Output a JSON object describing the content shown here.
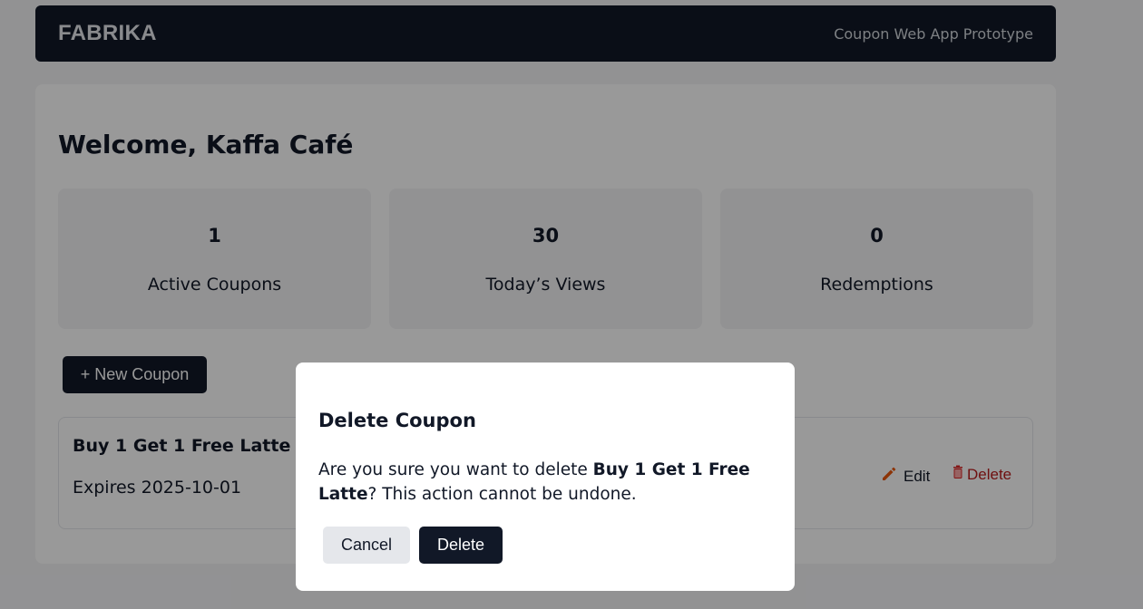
{
  "header": {
    "brand": "FABRIKA",
    "tagline": "Coupon Web App Prototype"
  },
  "dashboard": {
    "welcome": "Welcome, Kaffa Café",
    "stats": [
      {
        "value": "1",
        "label": "Active Coupons"
      },
      {
        "value": "30",
        "label": "Today’s Views"
      },
      {
        "value": "0",
        "label": "Redemptions"
      }
    ],
    "new_coupon_label": "+ New Coupon",
    "coupons": [
      {
        "title": "Buy 1 Get 1 Free Latte",
        "expires": "Expires 2025-10-01",
        "edit_label": "Edit",
        "delete_label": "Delete"
      }
    ]
  },
  "modal": {
    "title": "Delete Coupon",
    "message_prefix": "Are you sure you want to delete ",
    "coupon_name": "Buy 1 Get 1 Free Latte",
    "message_suffix": "? This action cannot be undone.",
    "cancel_label": "Cancel",
    "confirm_label": "Delete"
  },
  "icons": {
    "edit": "pencil-icon",
    "delete": "trash-icon"
  },
  "colors": {
    "primary": "#111827",
    "danger": "#b91c1c",
    "edit_icon": "#ea580c",
    "overlay": "rgba(0,0,0,0.4)"
  }
}
